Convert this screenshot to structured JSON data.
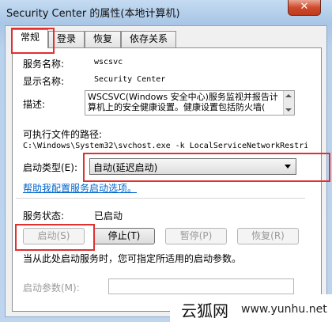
{
  "window": {
    "title": "Security Center 的属性(本地计算机)",
    "close_glyph": "✕"
  },
  "tabs": [
    "常规",
    "登录",
    "恢复",
    "依存关系"
  ],
  "general": {
    "service_name_label": "服务名称:",
    "service_name": "wscsvc",
    "display_name_label": "显示名称:",
    "display_name": "Security Center",
    "description_label": "描述:",
    "description": "WSCSVC(Windows 安全中心)服务监视并报告计算机上的安全健康设置。健康设置包括防火墙(",
    "exe_path_label": "可执行文件的路径:",
    "exe_path": "C:\\Windows\\System32\\svchost.exe -k LocalServiceNetworkRestri",
    "startup_type_label": "启动类型(E):",
    "startup_type": "自动(延迟启动)",
    "help_link": "帮助我配置服务启动选项。",
    "status_label": "服务状态:",
    "status": "已启动",
    "buttons": {
      "start": "启动(S)",
      "stop": "停止(T)",
      "pause": "暂停(P)",
      "resume": "恢复(R)"
    },
    "hint": "当从此处启动服务时，您可指定所适用的启动参数。",
    "start_params_label": "启动参数(M):"
  },
  "watermark": {
    "cn": "云狐网",
    "url": "www.yunhu.net"
  },
  "colors": {
    "highlight": "#e03030",
    "link": "#0066cc"
  }
}
